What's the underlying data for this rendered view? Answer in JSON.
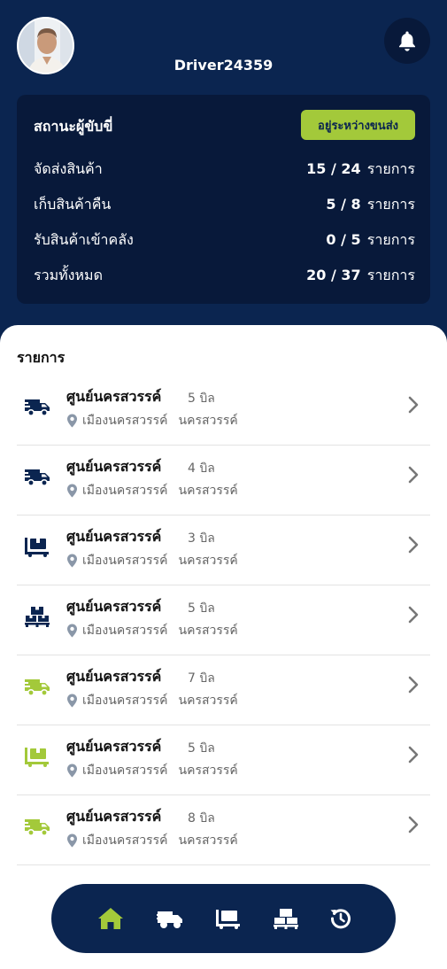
{
  "colors": {
    "navy": "#0b2550",
    "navy_dark": "#08193a",
    "accent_green": "#a3c93a",
    "text_muted": "#666666"
  },
  "header": {
    "avatar_icon": "user-avatar",
    "notification_icon": "bell-icon",
    "username": "Driver24359"
  },
  "status": {
    "title": "สถานะผู้ขับขี่",
    "badge": "อยู่ระหว่างขนส่ง",
    "rows": [
      {
        "label": "จัดส่งสินค้า",
        "done": "15",
        "total": "24",
        "unit": "รายการ"
      },
      {
        "label": "เก็บสินค้าคืน",
        "done": "5",
        "total": "8",
        "unit": "รายการ"
      },
      {
        "label": "รับสินค้าเข้าคลัง",
        "done": "0",
        "total": "5",
        "unit": "รายการ"
      },
      {
        "label": "รวมทั้งหมด",
        "done": "20",
        "total": "37",
        "unit": "รายการ"
      }
    ]
  },
  "list": {
    "title": "รายการ",
    "items": [
      {
        "name": "ศูนย์นครสวรรค์",
        "count": "5 บิล",
        "district": "เมืองนครสวรรค์",
        "province": "นครสวรรค์",
        "icon": "delivery-truck-icon",
        "color": "#0b2550"
      },
      {
        "name": "ศูนย์นครสวรรค์",
        "count": "4 บิล",
        "district": "เมืองนครสวรรค์",
        "province": "นครสวรรค์",
        "icon": "delivery-truck-icon",
        "color": "#0b2550"
      },
      {
        "name": "ศูนย์นครสวรรค์",
        "count": "3 บิล",
        "district": "เมืองนครสวรรค์",
        "province": "นครสวรรค์",
        "icon": "cart-box-icon",
        "color": "#0b2550"
      },
      {
        "name": "ศูนย์นครสวรรค์",
        "count": "5 บิล",
        "district": "เมืองนครสวรรค์",
        "province": "นครสวรรค์",
        "icon": "pallet-boxes-icon",
        "color": "#0b2550"
      },
      {
        "name": "ศูนย์นครสวรรค์",
        "count": "7 บิล",
        "district": "เมืองนครสวรรค์",
        "province": "นครสวรรค์",
        "icon": "delivery-truck-icon",
        "color": "#a3c93a"
      },
      {
        "name": "ศูนย์นครสวรรค์",
        "count": "5 บิล",
        "district": "เมืองนครสวรรค์",
        "province": "นครสวรรค์",
        "icon": "cart-box-icon",
        "color": "#a3c93a"
      },
      {
        "name": "ศูนย์นครสวรรค์",
        "count": "8 บิล",
        "district": "เมืองนครสวรรค์",
        "province": "นครสวรรค์",
        "icon": "delivery-truck-icon",
        "color": "#a3c93a"
      }
    ]
  },
  "bottom_nav": {
    "items": [
      {
        "icon": "home-icon",
        "active": true
      },
      {
        "icon": "delivery-truck-icon",
        "active": false
      },
      {
        "icon": "cart-box-icon",
        "active": false
      },
      {
        "icon": "pallet-boxes-icon",
        "active": false
      },
      {
        "icon": "history-icon",
        "active": false
      }
    ]
  }
}
